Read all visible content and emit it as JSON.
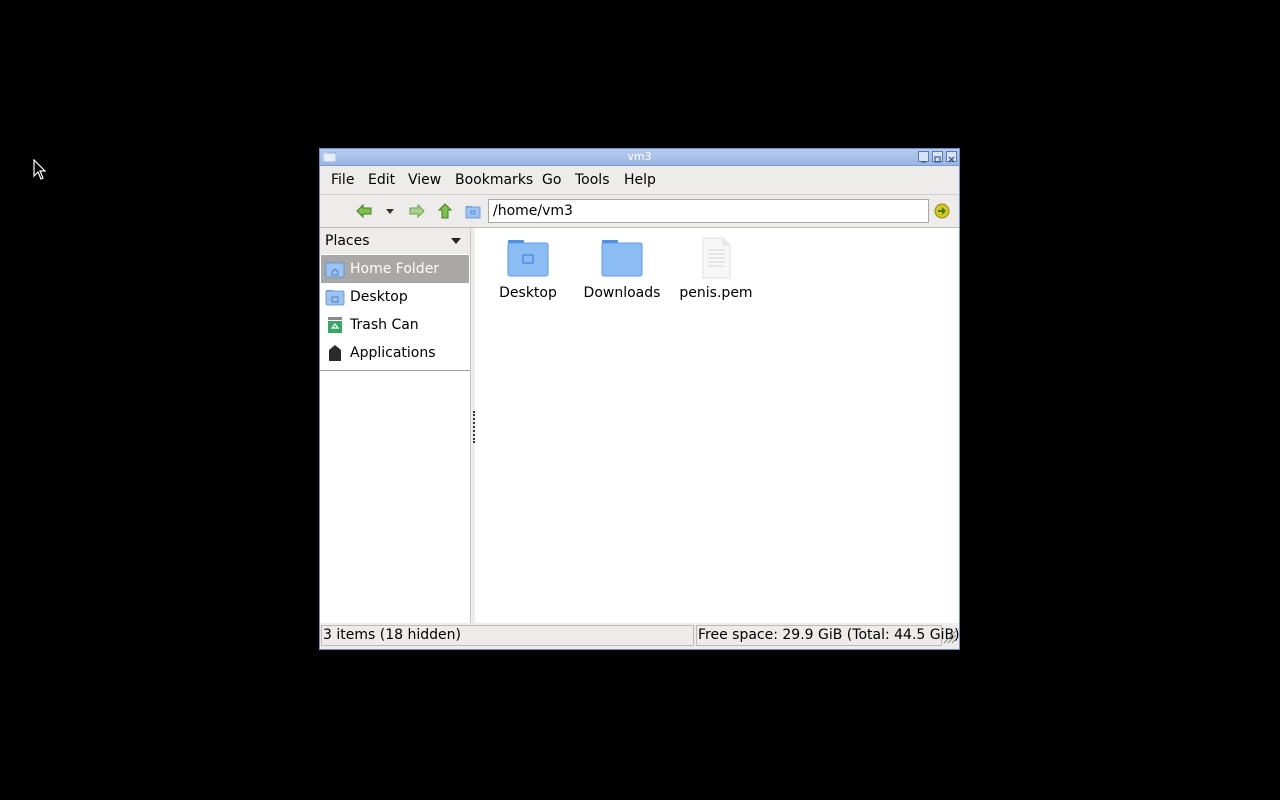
{
  "window": {
    "title": "vm3"
  },
  "menubar": {
    "items": [
      {
        "label": "File"
      },
      {
        "label": "Edit"
      },
      {
        "label": "View"
      },
      {
        "label": "Bookmarks"
      },
      {
        "label": "Go"
      },
      {
        "label": "Tools"
      },
      {
        "label": "Help"
      }
    ]
  },
  "toolbar": {
    "path": "/home/vm3",
    "icons": [
      "back-arrow-icon",
      "history-dropdown-icon",
      "forward-arrow-icon",
      "up-arrow-icon",
      "folder-icon",
      "go-icon"
    ]
  },
  "sidebar": {
    "header": "Places",
    "items": [
      {
        "label": "Home Folder",
        "icon": "home-folder-icon",
        "selected": true
      },
      {
        "label": "Desktop",
        "icon": "desktop-folder-icon",
        "selected": false
      },
      {
        "label": "Trash Can",
        "icon": "trash-icon",
        "selected": false
      },
      {
        "label": "Applications",
        "icon": "applications-icon",
        "selected": false
      }
    ]
  },
  "files": [
    {
      "name": "Desktop",
      "icon": "desktop-folder-icon"
    },
    {
      "name": "Downloads",
      "icon": "folder-icon"
    },
    {
      "name": "penis.pem",
      "icon": "text-file-icon"
    }
  ],
  "status": {
    "items": "3 items (18 hidden)",
    "free_space": "Free space: 29.9 GiB (Total: 44.5 GiB)"
  },
  "colors": {
    "titlebar": "#9ab5e3",
    "folder_blue": "#5d9be8",
    "selection": "#a9a8a6",
    "nav_green": "#4aa02c"
  }
}
